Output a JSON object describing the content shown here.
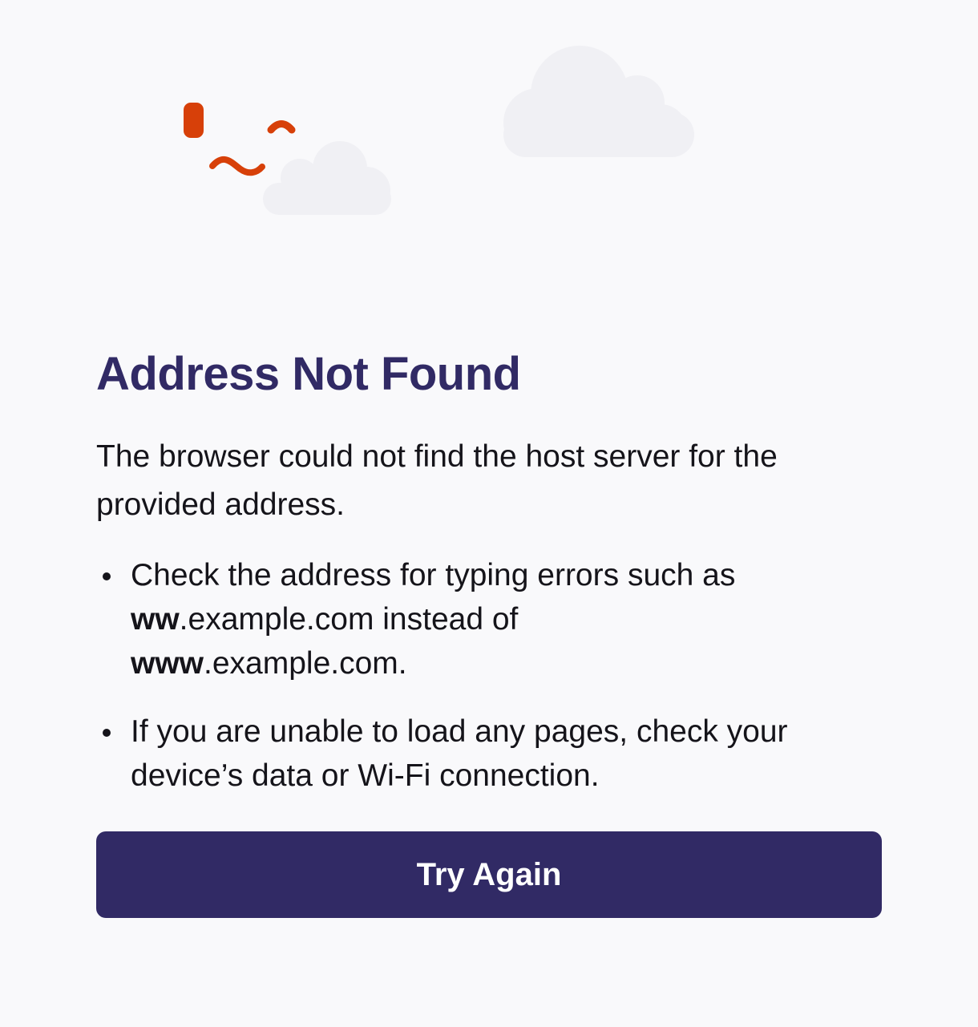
{
  "illustration": {
    "icon": "lost-connection-illustration",
    "accent_color": "#d74009",
    "cloud_color": "#f0f0f4"
  },
  "error": {
    "title": "Address Not Found",
    "description": "The browser could not find the host server for the provided address.",
    "tip1": {
      "line1": "Check the address for typing errors such as",
      "bad_prefix": "ww",
      "bad_suffix": ".example.com instead of",
      "good_prefix": "www",
      "good_suffix": ".example.com."
    },
    "tip2": "If you are unable to load any pages, check your device’s data or Wi-Fi connection."
  },
  "actions": {
    "try_again_label": "Try Again"
  },
  "colors": {
    "background": "#f9f9fb",
    "title": "#312a65",
    "button": "#312a65",
    "button_text": "#ffffff",
    "body_text": "#15141a"
  }
}
